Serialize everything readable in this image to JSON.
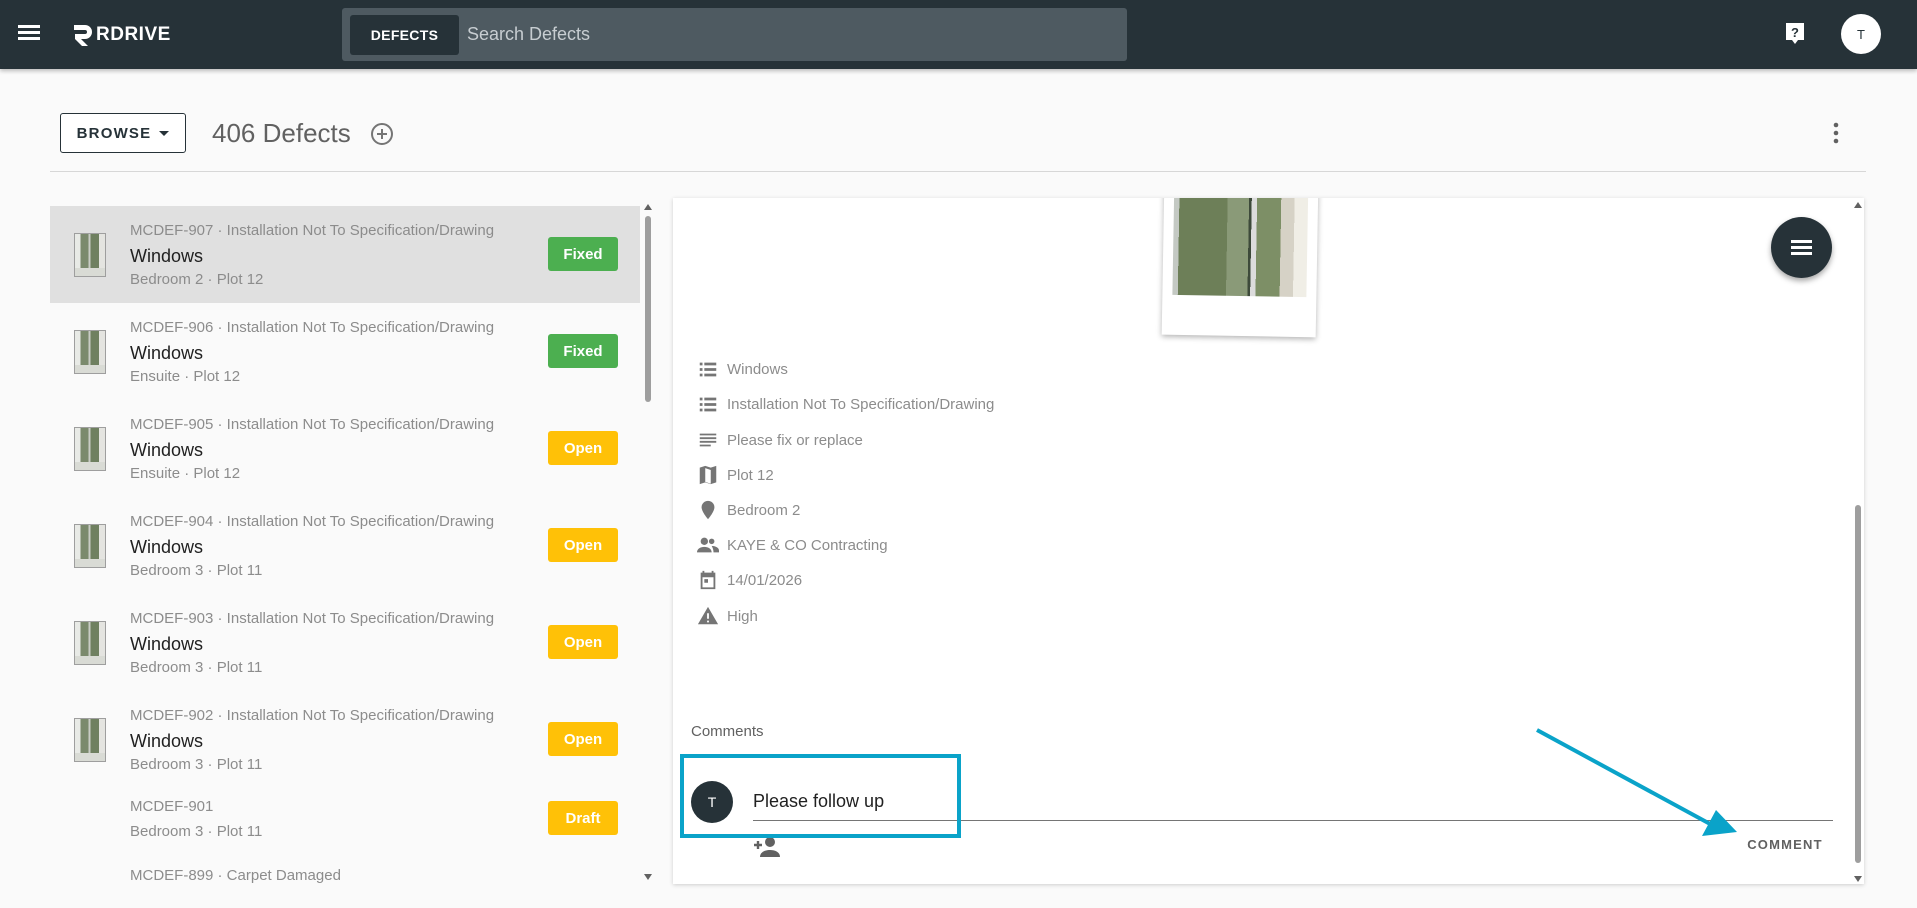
{
  "topbar": {
    "brand": "RDRIVE",
    "search_tab": "DEFECTS",
    "search_placeholder": "Search Defects",
    "avatar_initial": "T"
  },
  "header": {
    "browse_label": "BROWSE",
    "count_title": "406 Defects"
  },
  "list": {
    "items": [
      {
        "code": "MCDEF-907 · Installation Not To Specification/Drawing",
        "title": "Windows",
        "sub": "Bedroom 2 · Plot 12",
        "status": "Fixed",
        "selected": true
      },
      {
        "code": "MCDEF-906 · Installation Not To Specification/Drawing",
        "title": "Windows",
        "sub": "Ensuite · Plot 12",
        "status": "Fixed"
      },
      {
        "code": "MCDEF-905 · Installation Not To Specification/Drawing",
        "title": "Windows",
        "sub": "Ensuite · Plot 12",
        "status": "Open"
      },
      {
        "code": "MCDEF-904 · Installation Not To Specification/Drawing",
        "title": "Windows",
        "sub": "Bedroom 3 · Plot 11",
        "status": "Open"
      },
      {
        "code": "MCDEF-903 · Installation Not To Specification/Drawing",
        "title": "Windows",
        "sub": "Bedroom 3 · Plot 11",
        "status": "Open"
      },
      {
        "code": "MCDEF-902 · Installation Not To Specification/Drawing",
        "title": "Windows",
        "sub": "Bedroom 3 · Plot 11",
        "status": "Open"
      },
      {
        "code": "MCDEF-901",
        "sub": "Bedroom 3 · Plot 11",
        "status": "Draft"
      },
      {
        "code": "MCDEF-899 · Carpet Damaged"
      }
    ]
  },
  "detail": {
    "fields": [
      {
        "icon": "list-icon",
        "text": "Windows"
      },
      {
        "icon": "list-icon",
        "text": "Installation Not To Specification/Drawing"
      },
      {
        "icon": "notes-icon",
        "text": "Please fix or replace"
      },
      {
        "icon": "map-icon",
        "text": "Plot 12"
      },
      {
        "icon": "location-pin-icon",
        "text": "Bedroom 2"
      },
      {
        "icon": "people-icon",
        "text": "KAYE & CO Contracting"
      },
      {
        "icon": "calendar-icon",
        "text": "14/01/2026"
      },
      {
        "icon": "warning-icon",
        "text": "High"
      }
    ],
    "comments_label": "Comments",
    "comment_avatar": "T",
    "comment_value": "Please follow up",
    "comment_button": "COMMENT"
  },
  "colors": {
    "topbar": "#263238",
    "fixed": "#4caf50",
    "open": "#ffc107",
    "annotation": "#0aa3c9"
  }
}
